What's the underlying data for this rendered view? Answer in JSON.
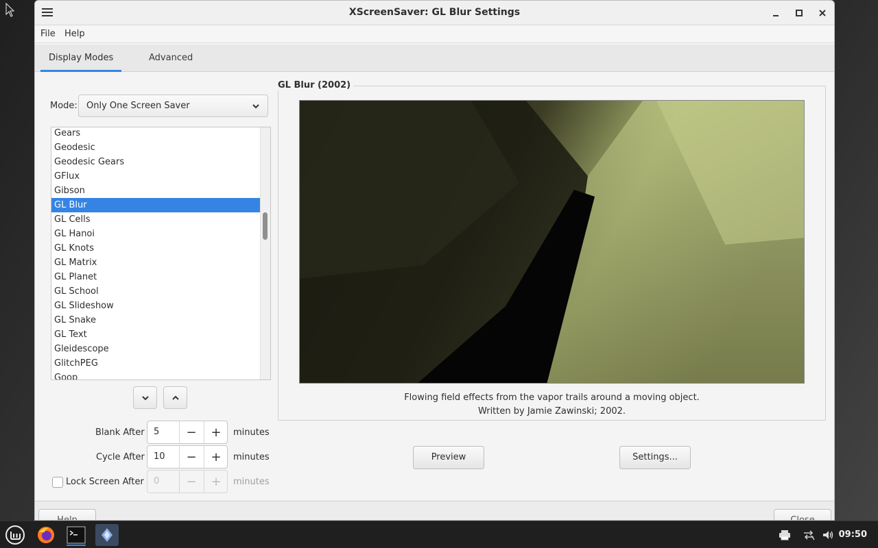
{
  "window": {
    "title": "XScreenSaver: GL Blur Settings",
    "controls": {
      "minimize": "minimize-icon",
      "maximize": "maximize-icon",
      "close": "close-icon"
    }
  },
  "menubar": {
    "file": "File",
    "help": "Help"
  },
  "tabs": [
    {
      "label": "Display Modes",
      "active": true
    },
    {
      "label": "Advanced",
      "active": false
    }
  ],
  "mode": {
    "label": "Mode:",
    "value": "Only One Screen Saver"
  },
  "savers": {
    "items": [
      "Gears",
      "Geodesic",
      "Geodesic Gears",
      "GFlux",
      "Gibson",
      "GL Blur",
      "GL Cells",
      "GL Hanoi",
      "GL Knots",
      "GL Matrix",
      "GL Planet",
      "GL School",
      "GL Slideshow",
      "GL Snake",
      "GL Text",
      "Gleidescope",
      "GlitchPEG",
      "Goop"
    ],
    "selected": "GL Blur"
  },
  "timers": {
    "blank_label": "Blank After",
    "blank_value": "5",
    "cycle_label": "Cycle After",
    "cycle_value": "10",
    "lock_label": "Lock Screen After",
    "lock_value": "0",
    "unit": "minutes",
    "minus": "−",
    "plus": "+"
  },
  "preview": {
    "frame_title": "GL Blur (2002)",
    "description_line1": "Flowing field effects from the vapor trails around a moving object.",
    "description_line2": "Written by Jamie Zawinski; 2002.",
    "preview_button": "Preview",
    "settings_button": "Settings..."
  },
  "bottom": {
    "help_button": "Help",
    "close_button": "Close"
  },
  "taskbar": {
    "clock": "09:50"
  },
  "colors": {
    "accent": "#3584e4",
    "preview_green": "#a8b070"
  }
}
